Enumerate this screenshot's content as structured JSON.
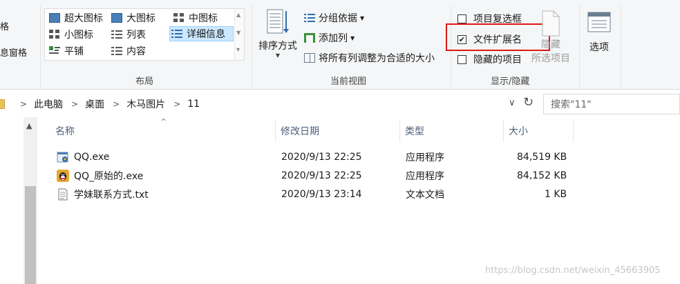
{
  "ribbon": {
    "left_stub": [
      "格",
      "息窗格"
    ],
    "layout_group": {
      "label": "布局",
      "items": [
        {
          "label": "超大图标",
          "icon": "extra-large-icons-icon"
        },
        {
          "label": "大图标",
          "icon": "large-icons-icon"
        },
        {
          "label": "中图标",
          "icon": "medium-icons-icon"
        },
        {
          "label": "小图标",
          "icon": "small-icons-icon"
        },
        {
          "label": "列表",
          "icon": "list-icon"
        },
        {
          "label": "详细信息",
          "icon": "details-icon",
          "selected": true
        },
        {
          "label": "平铺",
          "icon": "tiles-icon"
        },
        {
          "label": "内容",
          "icon": "content-icon"
        }
      ]
    },
    "current_view_group": {
      "label": "当前视图",
      "sort_label": "排序方式",
      "group_by_label": "分组依据",
      "add_column_label": "添加列",
      "fit_columns_label": "将所有列调整为合适的大小"
    },
    "show_hide_group": {
      "label": "显示/隐藏",
      "item_checkboxes": {
        "label": "项目复选框",
        "checked": false
      },
      "file_extensions": {
        "label": "文件扩展名",
        "checked": true
      },
      "hidden_items": {
        "label": "隐藏的项目",
        "checked": false
      },
      "hide_selected_line1": "隐藏",
      "hide_selected_line2": "所选项目"
    },
    "options_label": "选项"
  },
  "address": {
    "breadcrumbs": [
      "此电脑",
      "桌面",
      "木马图片",
      "11"
    ],
    "search_placeholder": "搜索\"11\""
  },
  "columns": [
    "名称",
    "修改日期",
    "类型",
    "大小"
  ],
  "files": [
    {
      "name": "QQ.exe",
      "date": "2020/9/13 22:25",
      "type": "应用程序",
      "size": "84,519 KB",
      "icon": "exe-icon"
    },
    {
      "name": "QQ_原始的.exe",
      "date": "2020/9/13 22:25",
      "type": "应用程序",
      "size": "84,152 KB",
      "icon": "qq-penguin-icon"
    },
    {
      "name": "学妹联系方式.txt",
      "date": "2020/9/13 23:14",
      "type": "文本文档",
      "size": "1 KB",
      "icon": "text-file-icon"
    }
  ],
  "watermark": "https://blog.csdn.net/weixin_45663905",
  "colors": {
    "highlight_red": "#e01616",
    "selection_blue": "#cce8ff",
    "header_text": "#4c607a"
  }
}
